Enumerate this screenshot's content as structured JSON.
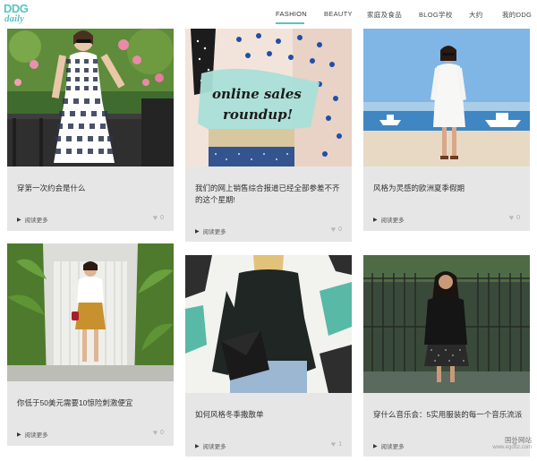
{
  "logo": {
    "line1": "DDG",
    "line2": "daily"
  },
  "nav": [
    {
      "label": "FASHION",
      "active": true
    },
    {
      "label": "BEAUTY"
    },
    {
      "label": "家庭及食品"
    },
    {
      "label": "BLOG学校"
    },
    {
      "label": "大约"
    },
    {
      "label": "我的DDG"
    }
  ],
  "posts": [
    {
      "title": "穿第一次约会是什么",
      "more": "阅读更多",
      "likes": "0"
    },
    {
      "title": "我们的网上销售综合报道已经全部参差不齐的这个星期!",
      "more": "阅读更多",
      "likes": "0",
      "image_text": "online sales roundup!"
    },
    {
      "title": "风格为灵感的欧洲夏季假期",
      "more": "阅读更多",
      "likes": "0"
    },
    {
      "title": "你低于50美元需要10惊险刺激便宜",
      "more": "阅读更多",
      "likes": "0"
    },
    {
      "title": "如何风格冬季撒散单",
      "more": "阅读更多",
      "likes": "1"
    },
    {
      "title": "穿什么音乐会：5实用服装的每一个音乐流派",
      "more": "阅读更多",
      "likes": ""
    }
  ],
  "watermark": {
    "line1": "国外网站",
    "line2": "www.egouz.com"
  },
  "colors": {
    "accent": "#59c5bb",
    "card_bg": "#e6e6e6"
  }
}
